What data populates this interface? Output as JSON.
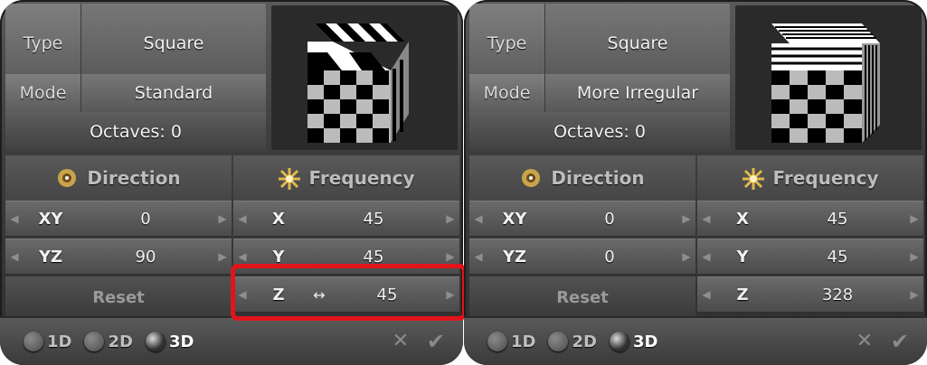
{
  "panels": [
    {
      "type_label": "Type",
      "type_value": "Square",
      "mode_label": "Mode",
      "mode_value": "Standard",
      "octaves": "Octaves: 0",
      "direction_label": "Direction",
      "frequency_label": "Frequency",
      "xy_label": "XY",
      "xy_value": "0",
      "yz_label": "YZ",
      "yz_value": "90",
      "x_label": "X",
      "x_value": "45",
      "y_label": "Y",
      "y_value": "45",
      "z_label": "Z",
      "z_value": "45",
      "reset_label": "Reset",
      "mode_options": [
        "1D",
        "2D",
        "3D"
      ],
      "selected_mode": "3D",
      "cancel_icon": "x-icon",
      "ok_icon": "check-icon"
    },
    {
      "type_label": "Type",
      "type_value": "Square",
      "mode_label": "Mode",
      "mode_value": "More Irregular",
      "octaves": "Octaves: 0",
      "direction_label": "Direction",
      "frequency_label": "Frequency",
      "xy_label": "XY",
      "xy_value": "0",
      "yz_label": "YZ",
      "yz_value": "0",
      "x_label": "X",
      "x_value": "45",
      "y_label": "Y",
      "y_value": "45",
      "z_label": "Z",
      "z_value": "328",
      "reset_label": "Reset",
      "mode_options": [
        "1D",
        "2D",
        "3D"
      ],
      "selected_mode": "3D",
      "cancel_icon": "x-icon",
      "ok_icon": "check-icon"
    }
  ],
  "colors": {
    "highlight": "#e0141b"
  }
}
